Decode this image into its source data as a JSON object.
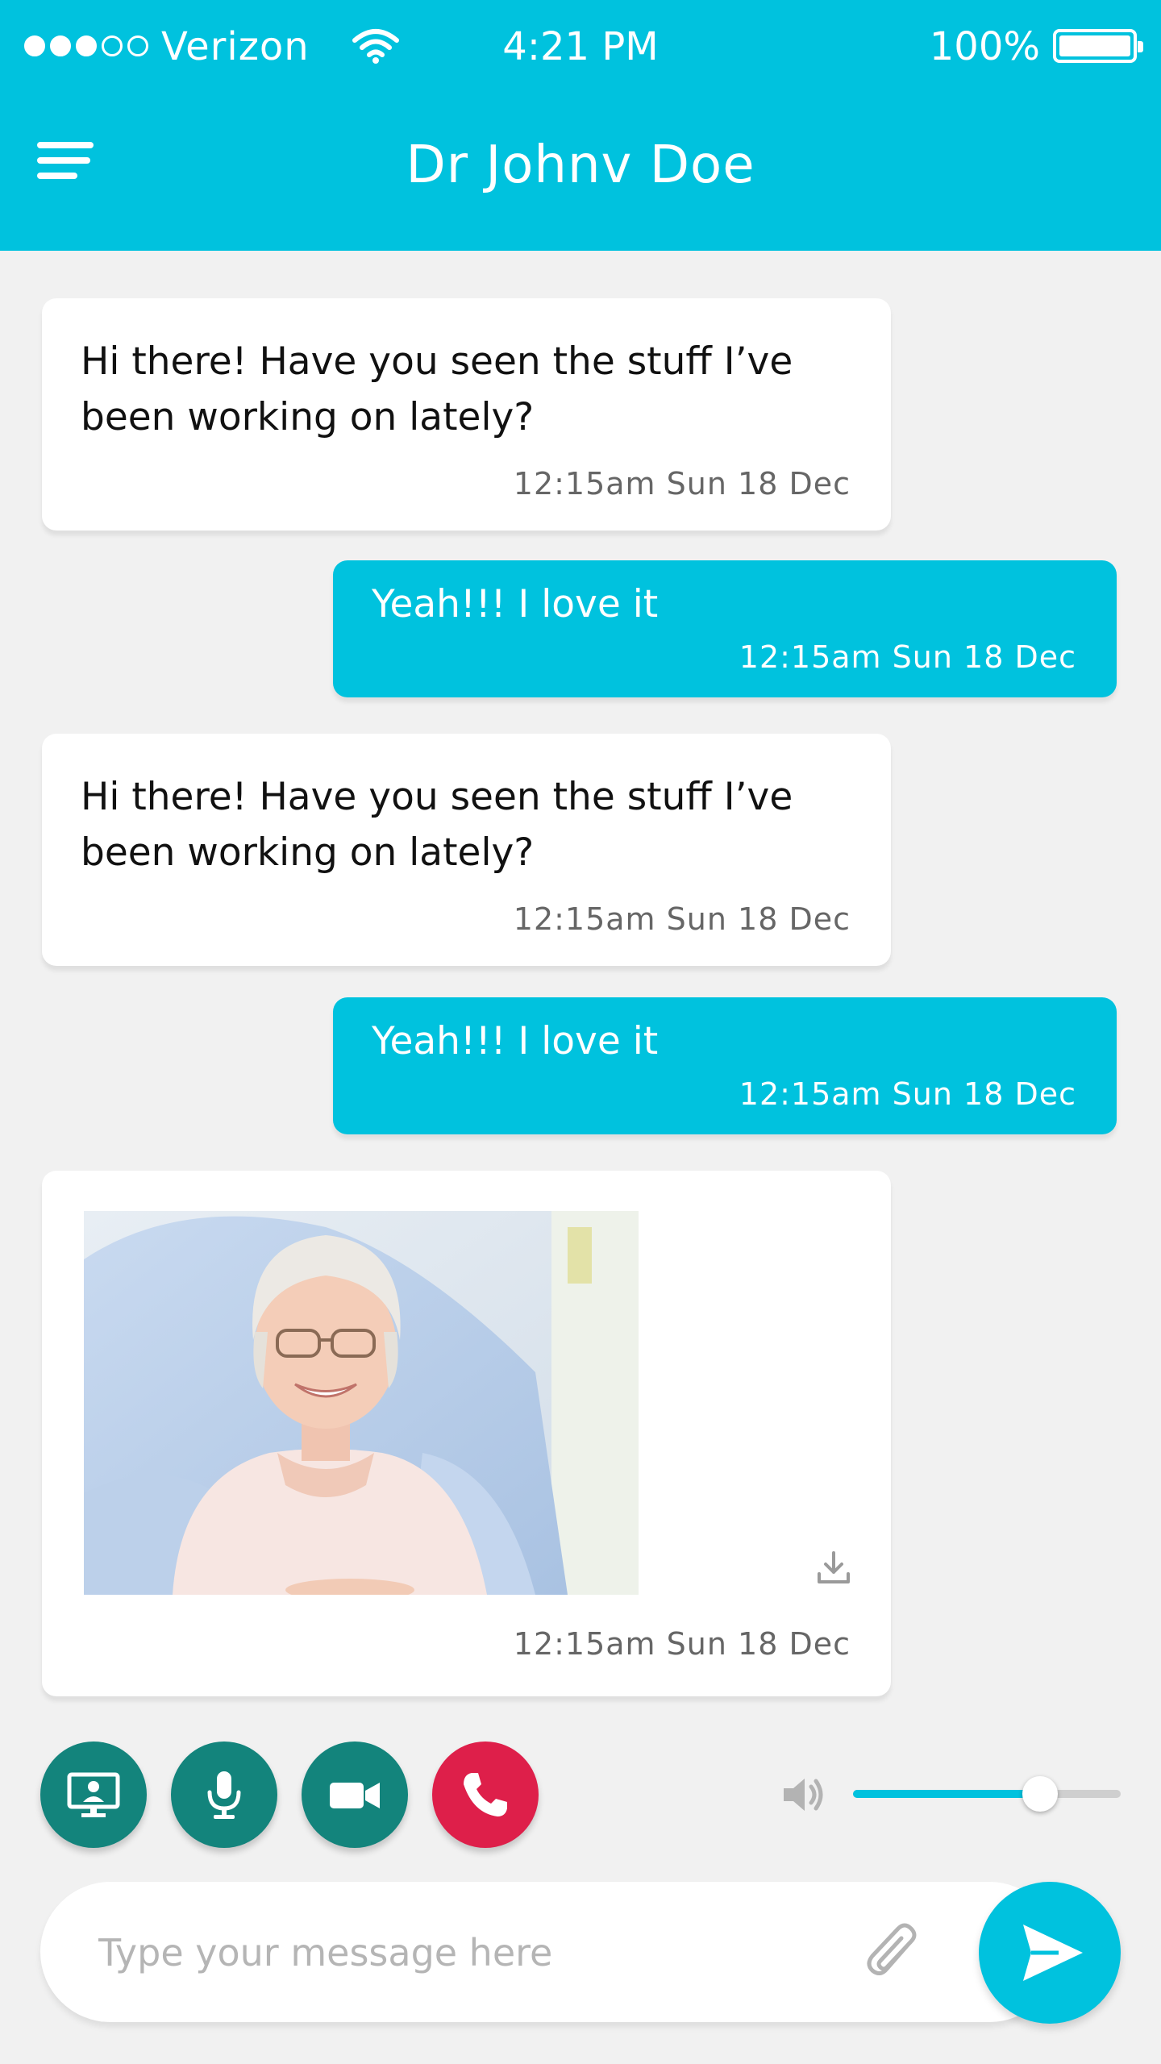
{
  "status_bar": {
    "carrier": "Verizon",
    "time": "4:21 PM",
    "battery_percent": "100%",
    "signal_bars_filled": 3,
    "signal_bars_total": 5
  },
  "header": {
    "title": "Dr Johnv Doe",
    "background_color": "#00c2de"
  },
  "messages": [
    {
      "direction": "incoming",
      "text": "Hi there! Have you seen the stuff  I’ve been working on lately?",
      "timestamp": "12:15am Sun 18 Dec"
    },
    {
      "direction": "outgoing",
      "text": "Yeah!!! I love it",
      "timestamp": "12:15am Sun 18 Dec"
    },
    {
      "direction": "incoming",
      "text": "Hi there! Have you seen the stuff  I’ve been working on lately?",
      "timestamp": "12:15am Sun 18 Dec"
    },
    {
      "direction": "outgoing",
      "text": "Yeah!!! I love it",
      "timestamp": "12:15am Sun 18 Dec"
    },
    {
      "direction": "incoming",
      "type": "image",
      "image_alt": "Smiling elderly woman sitting in a hospital bed",
      "timestamp": "12:15am Sun 18 Dec"
    }
  ],
  "call_controls": {
    "buttons": [
      "screen-share-icon",
      "microphone-icon",
      "video-camera-icon",
      "phone-end-icon"
    ],
    "control_color": "#13847c",
    "end_call_color": "#de1f4a"
  },
  "volume": {
    "level": 0.7
  },
  "composer": {
    "placeholder": "Type your message here",
    "value": ""
  }
}
